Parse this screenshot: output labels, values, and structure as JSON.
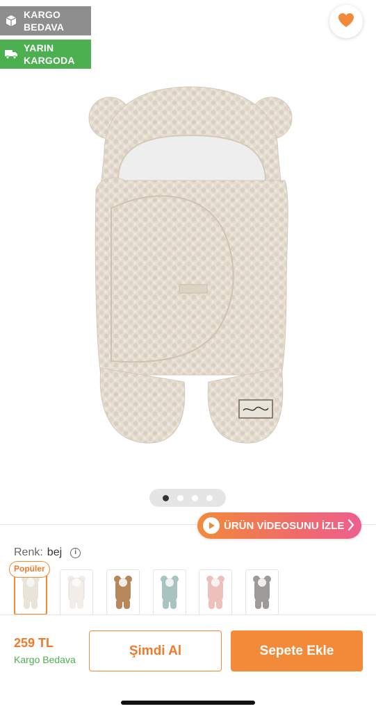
{
  "badges": [
    {
      "line1": "KARGO",
      "line2": "BEDAVA",
      "icon": "box-icon",
      "color": "#8e8e8e"
    },
    {
      "line1": "YARIN",
      "line2": "KARGODA",
      "icon": "truck-icon",
      "color": "#4caf50"
    }
  ],
  "favorite": {
    "icon": "heart-icon",
    "color": "#f28a3a"
  },
  "gallery": {
    "total_images": 4,
    "active_index": 0
  },
  "video_button": {
    "label": "ÜRÜN VİDEOSUNU İZLE"
  },
  "color_selector": {
    "label": "Renk:",
    "value": "bej",
    "popular_tag": "Popüler",
    "swatches": [
      {
        "name": "bej",
        "color": "#e9e3d8",
        "selected": true
      },
      {
        "name": "beyaz",
        "color": "#f4f2ee",
        "selected": false
      },
      {
        "name": "kahverengi",
        "color": "#b5875b",
        "selected": false
      },
      {
        "name": "mint",
        "color": "#a9c3c0",
        "selected": false
      },
      {
        "name": "pembe",
        "color": "#edc0bc",
        "selected": false
      },
      {
        "name": "gri",
        "color": "#9d9a98",
        "selected": false
      }
    ]
  },
  "purchase": {
    "price": "259 TL",
    "shipping": "Kargo Bedava",
    "buy_now_label": "Şimdi Al",
    "add_to_cart_label": "Sepete Ekle"
  },
  "theme": {
    "accent": "#f28a3a",
    "green": "#4caf50"
  }
}
